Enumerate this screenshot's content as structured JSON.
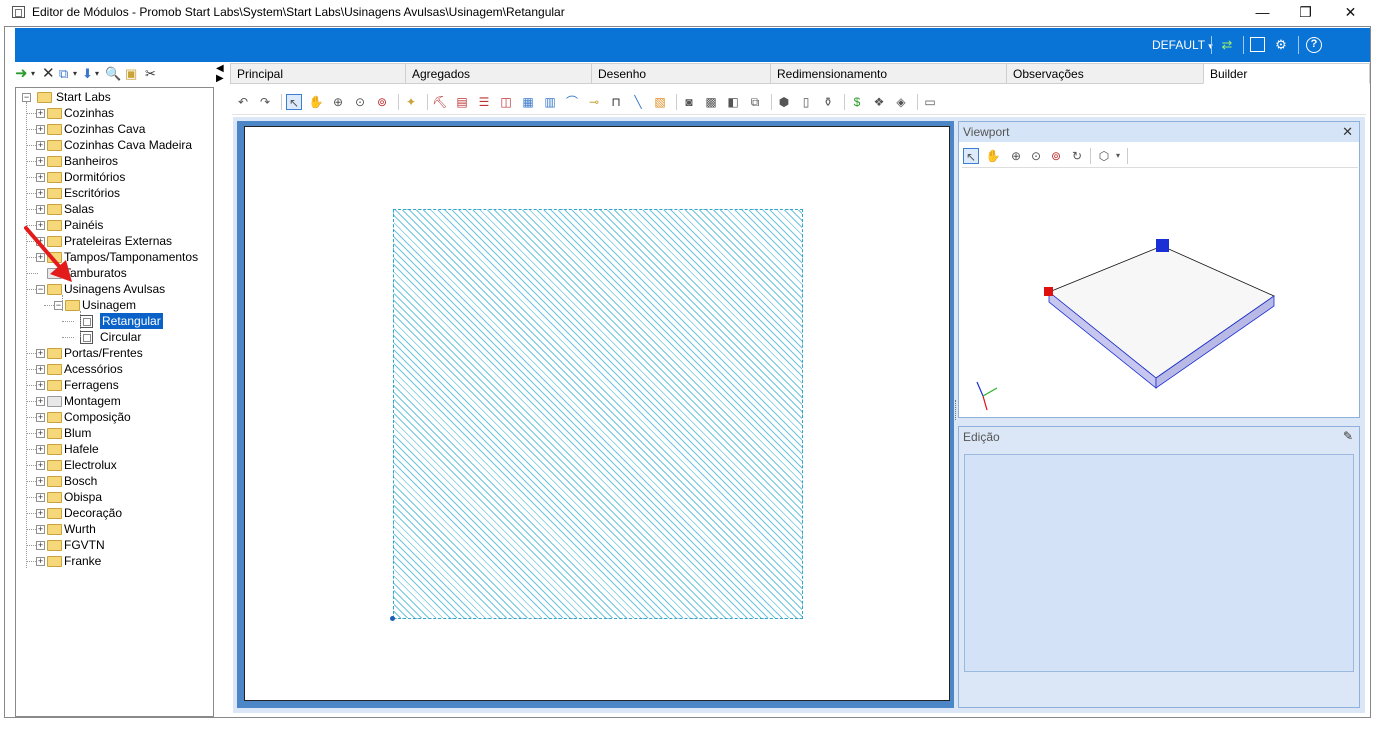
{
  "window": {
    "title": "Editor de Módulos - Promob Start Labs\\System\\Start Labs\\Usinagens Avulsas\\Usinagem\\Retangular",
    "minimize": "—",
    "restore": "❐",
    "close": "✕"
  },
  "header": {
    "profile_label": "DEFAULT",
    "profile_caret": "▾",
    "icons": [
      "refresh-icon",
      "layout-icon",
      "settings-icon",
      "help-icon"
    ]
  },
  "tree": {
    "root": "Start Labs",
    "items": [
      {
        "label": "Cozinhas"
      },
      {
        "label": "Cozinhas Cava"
      },
      {
        "label": "Cozinhas Cava Madeira"
      },
      {
        "label": "Banheiros"
      },
      {
        "label": "Dormitórios"
      },
      {
        "label": "Escritórios"
      },
      {
        "label": "Salas"
      },
      {
        "label": "Painéis"
      },
      {
        "label": "Prateleiras Externas"
      },
      {
        "label": "Tampos/Tamponamentos"
      },
      {
        "label": "Tamburatos"
      },
      {
        "label": "Usinagens Avulsas"
      },
      {
        "label": "Usinagem"
      },
      {
        "label": "Retangular"
      },
      {
        "label": "Circular"
      },
      {
        "label": "Portas/Frentes"
      },
      {
        "label": "Acessórios"
      },
      {
        "label": "Ferragens"
      },
      {
        "label": "Montagem"
      },
      {
        "label": "Composição"
      },
      {
        "label": "Blum"
      },
      {
        "label": "Hafele"
      },
      {
        "label": "Electrolux"
      },
      {
        "label": "Bosch"
      },
      {
        "label": "Obispa"
      },
      {
        "label": "Decoração"
      },
      {
        "label": "Wurth"
      },
      {
        "label": "FGVTN"
      },
      {
        "label": "Franke"
      }
    ],
    "selected": "Retangular"
  },
  "tabs": [
    {
      "label": "Principal"
    },
    {
      "label": "Agregados"
    },
    {
      "label": "Desenho"
    },
    {
      "label": "Redimensionamento"
    },
    {
      "label": "Observações"
    },
    {
      "label": "Builder"
    }
  ],
  "active_tab": "Builder",
  "viewport": {
    "title": "Viewport",
    "close": "✕"
  },
  "edicao": {
    "title": "Edição",
    "pin": "📌"
  },
  "colors": {
    "accent_blue": "#0a74d6",
    "hatch": "#6cc4df",
    "selection": "#0a62c8",
    "handle_blue": "#1a2fd6",
    "handle_red": "#e01010",
    "annotation_arrow": "#e31b1b"
  }
}
